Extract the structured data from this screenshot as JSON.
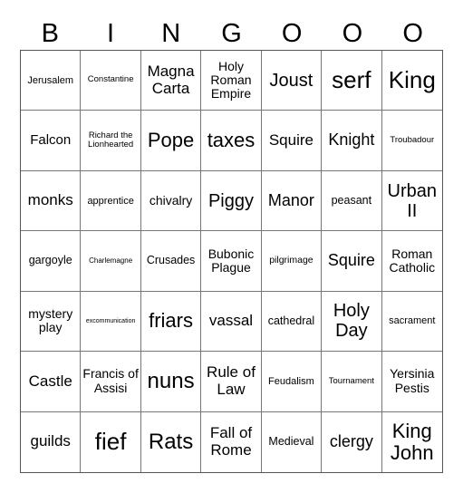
{
  "header": [
    "B",
    "I",
    "N",
    "G",
    "O",
    "O",
    "O"
  ],
  "rows": [
    [
      "Jerusalem",
      "Constantine",
      "Magna Carta",
      "Holy Roman Empire",
      "Joust",
      "serf",
      "King"
    ],
    [
      "Falcon",
      "Richard the Lionhearted",
      "Pope",
      "taxes",
      "Squire",
      "Knight",
      "Troubadour"
    ],
    [
      "monks",
      "apprentice",
      "chivalry",
      "Piggy",
      "Manor",
      "peasant",
      "Urban II"
    ],
    [
      "gargoyle",
      "Charlemagne",
      "Crusades",
      "Bubonic Plague",
      "pilgrimage",
      "Squire",
      "Roman Catholic"
    ],
    [
      "mystery play",
      "excommunication",
      "friars",
      "vassal",
      "cathedral",
      "Holy Day",
      "sacrament"
    ],
    [
      "Castle",
      "Francis of Assisi",
      "nuns",
      "Rule of Law",
      "Feudalism",
      "Tournament",
      "Yersinia Pestis"
    ],
    [
      "guilds",
      "fief",
      "Rats",
      "Fall of Rome",
      "Medieval",
      "clergy",
      "King John"
    ]
  ]
}
